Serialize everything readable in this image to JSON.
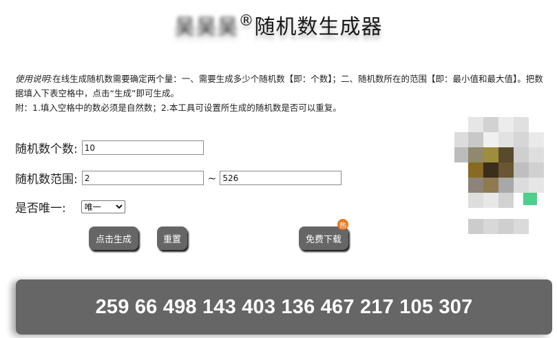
{
  "header": {
    "brand": "吴吴吴",
    "reg_mark": "®",
    "title": "随机数生成器"
  },
  "instructions": {
    "lead": "使用说明:",
    "line1": "在线生成随机数需要确定两个量：一、需要生成多少个随机数【即：个数】；二、随机数所在的范围【即：最小值和最大值】。把数据填入下表空格中，点击“生成”即可生成。",
    "line2": "附：1.填入空格中的数必须是自然数；2.本工具可设置所生成的随机数是否可以重复。"
  },
  "form": {
    "count_label": "随机数个数:",
    "count_value": "10",
    "range_label": "随机数范围:",
    "range_min": "2",
    "range_separator": "~",
    "range_max": "526",
    "unique_label": "是否唯一:",
    "unique_selected": "唯一"
  },
  "buttons": {
    "generate": "点击生成",
    "reset": "重置",
    "download": "免费下载",
    "download_badge": "热"
  },
  "result": {
    "text": "259 66 498 143 403 136 467 217 105 307"
  },
  "colors": {
    "button_bg": "#666666",
    "result_bg": "#666666",
    "badge": "#e8791c"
  },
  "icons": {
    "qr": "qr-code-icon"
  }
}
